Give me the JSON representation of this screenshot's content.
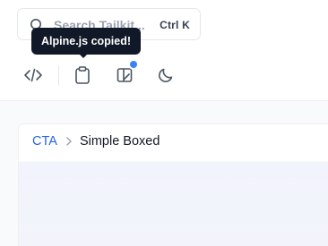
{
  "search": {
    "placeholder": "Search Tailkit...",
    "shortcut": "Ctrl K"
  },
  "tooltip": {
    "text": "Alpine.js copied!"
  },
  "toolbar": {
    "items": [
      {
        "icon": "code-icon"
      },
      {
        "icon": "clipboard-icon"
      },
      {
        "icon": "preview-layout-icon",
        "has_notification": true
      },
      {
        "icon": "moon-icon"
      }
    ]
  },
  "breadcrumb": {
    "parent": "CTA",
    "current": "Simple Boxed"
  },
  "colors": {
    "accent": "#2563eb",
    "notification": "#3b82f6",
    "tooltip_bg": "#111827"
  }
}
